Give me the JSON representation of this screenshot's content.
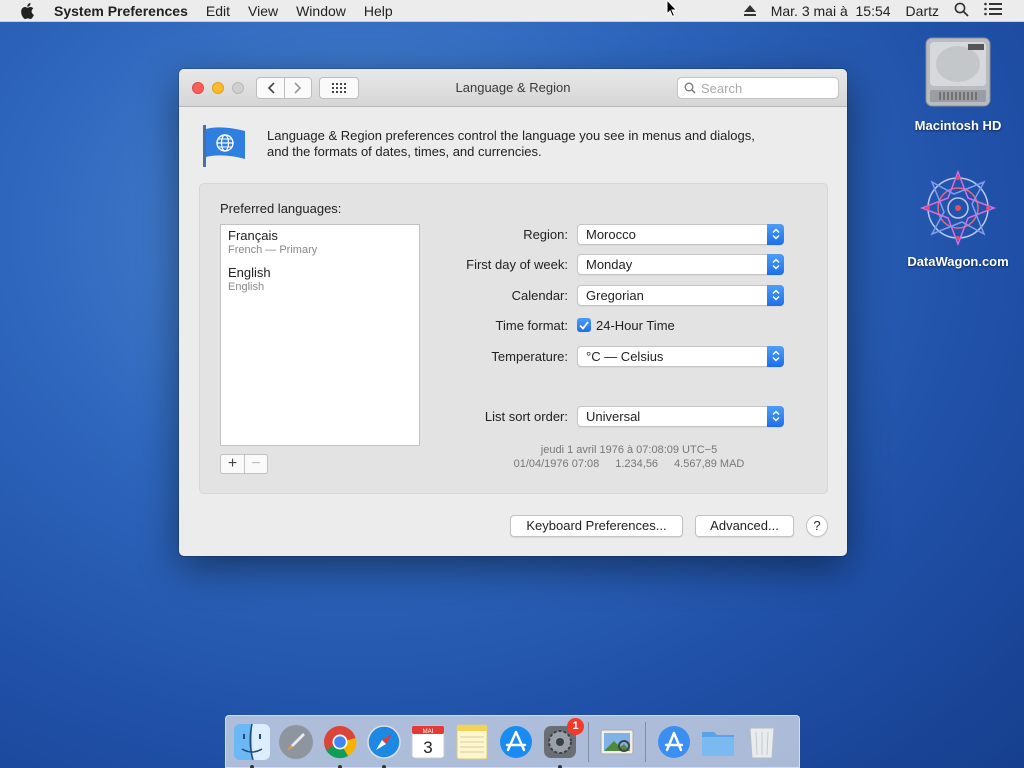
{
  "menubar": {
    "app_name": "System Preferences",
    "items": [
      "Edit",
      "View",
      "Window",
      "Help"
    ],
    "datetime": "Mar. 3 mai à  15:54",
    "user": "Dartz"
  },
  "desktop": {
    "icons": [
      {
        "label": "Macintosh HD"
      },
      {
        "label": "DataWagon.com"
      }
    ]
  },
  "window": {
    "title": "Language & Region",
    "search_placeholder": "Search",
    "description_line1": "Language & Region preferences control the language you see in menus and dialogs,",
    "description_line2": "and the formats of dates, times, and currencies.",
    "preferred_label": "Preferred languages:",
    "languages": [
      {
        "name": "Français",
        "sub": "French — Primary"
      },
      {
        "name": "English",
        "sub": "English"
      }
    ],
    "add_label": "+",
    "remove_label": "−",
    "region_label": "Region:",
    "region_value": "Morocco",
    "first_day_label": "First day of week:",
    "first_day_value": "Monday",
    "calendar_label": "Calendar:",
    "calendar_value": "Gregorian",
    "time_format_label": "Time format:",
    "time_format_value": "24-Hour Time",
    "time_format_checked": true,
    "temperature_label": "Temperature:",
    "temperature_value": "°C — Celsius",
    "sort_label": "List sort order:",
    "sort_value": "Universal",
    "sample_line1": "jeudi 1 avril 1976 à 07:08:09 UTC−5",
    "sample_date": "01/04/1976 07:08",
    "sample_number": "1.234,56",
    "sample_currency": "4.567,89 MAD",
    "keyboard_btn": "Keyboard Preferences...",
    "advanced_btn": "Advanced...",
    "help_btn": "?"
  },
  "dock": {
    "calendar_month": "MAI",
    "calendar_day": "3",
    "sysprefs_badge": "1"
  },
  "colors": {
    "accent": "#1d6fe8",
    "desktop": "#2f68be",
    "close": "#fc5f57",
    "minimize": "#fdbc2e"
  }
}
